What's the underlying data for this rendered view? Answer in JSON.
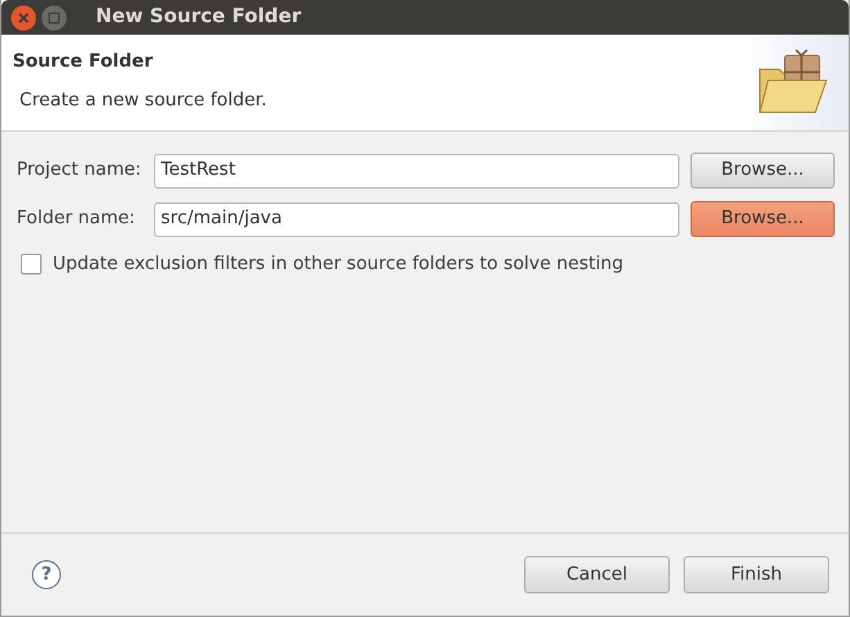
{
  "window": {
    "title": "New Source Folder"
  },
  "header": {
    "title": "Source Folder",
    "description": "Create a new source folder."
  },
  "fields": [
    {
      "label": "Project name:",
      "value": "TestRest",
      "button": "Browse...",
      "focused": false
    },
    {
      "label": "Folder name:",
      "value": "src/main/java",
      "button": "Browse...",
      "focused": true
    }
  ],
  "option": {
    "label": "Update exclusion filters in other source folders to solve nesting",
    "checked": false
  },
  "help": "?",
  "buttons": [
    "Cancel",
    "Finish"
  ]
}
